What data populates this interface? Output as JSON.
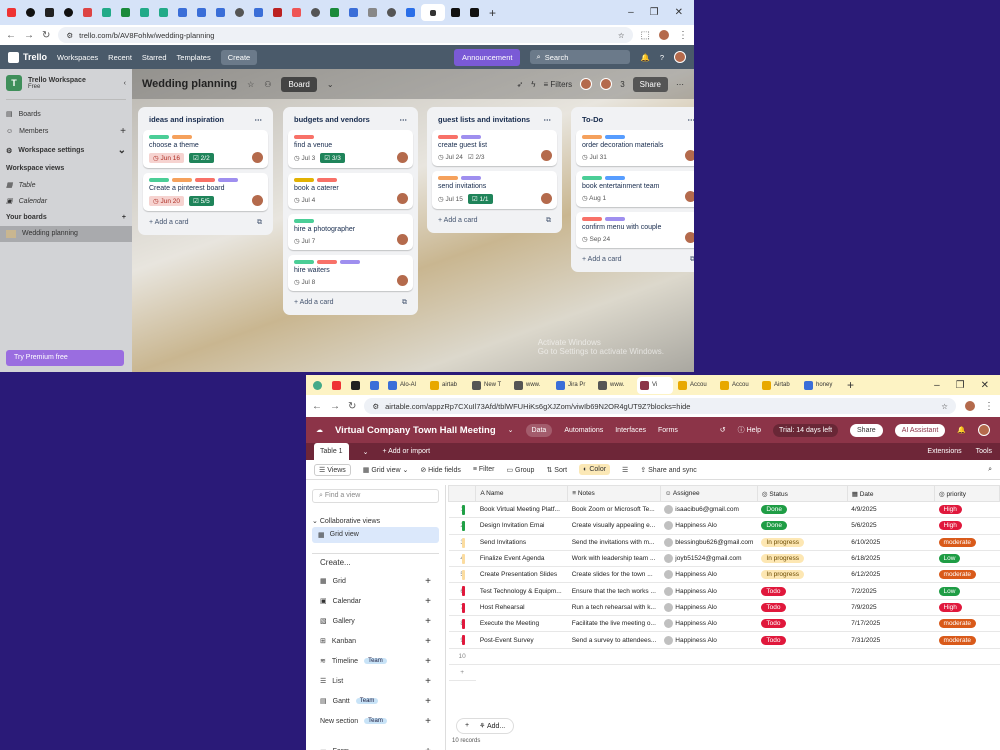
{
  "trello_window": {
    "url": "trello.com/b/AV8Fohlw/wedding-planning",
    "nav": {
      "logo": "Trello",
      "workspaces": "Workspaces",
      "recent": "Recent",
      "starred": "Starred",
      "templates": "Templates",
      "create": "Create",
      "announcement": "Announcement",
      "search_placeholder": "Search"
    },
    "sidebar": {
      "workspace_name": "Trello Workspace",
      "plan": "Free",
      "logo_letter": "T",
      "items": [
        {
          "label": "Boards"
        },
        {
          "label": "Members"
        },
        {
          "label": "Workspace settings"
        }
      ],
      "views_header": "Workspace views",
      "views": [
        {
          "label": "Table"
        },
        {
          "label": "Calendar"
        }
      ],
      "boards_header": "Your boards",
      "board": "Wedding planning",
      "premium": "Try Premium free"
    },
    "board": {
      "title": "Wedding planning",
      "view": "Board",
      "filters": "Filters",
      "share": "Share",
      "member_count": "3",
      "lists": [
        {
          "title": "ideas and inspiration",
          "cards": [
            {
              "title": "choose a theme",
              "labels": [
                "#4bce97",
                "#f5a15c"
              ],
              "due": "Jun 16",
              "check": "2/2"
            },
            {
              "title": "Create a pinterest board",
              "labels": [
                "#4bce97",
                "#f5a15c",
                "#f87168",
                "#9f8fef"
              ],
              "due": "Jun 20",
              "check": "5/5"
            }
          ],
          "add": "Add a card"
        },
        {
          "title": "budgets and vendors",
          "cards": [
            {
              "title": "find a venue",
              "labels": [
                "#f87168"
              ],
              "date": "Jul 3",
              "check": "3/3"
            },
            {
              "title": "book a caterer",
              "labels": [
                "#e2b203",
                "#f87168"
              ],
              "date": "Jul 4"
            },
            {
              "title": "hire a photographer",
              "labels": [
                "#4bce97"
              ],
              "date": "Jul 7"
            },
            {
              "title": "hire waiters",
              "labels": [
                "#4bce97",
                "#f87168",
                "#9f8fef"
              ],
              "date": "Jul 8"
            }
          ],
          "add": "Add a card"
        },
        {
          "title": "guest lists and invitations",
          "cards": [
            {
              "title": "create guest list",
              "labels": [
                "#f87168",
                "#9f8fef"
              ],
              "date": "Jul 24",
              "check": "2/3"
            },
            {
              "title": "send invitations",
              "labels": [
                "#f5a15c",
                "#9f8fef"
              ],
              "date": "Jul 15",
              "check": "1/1"
            }
          ],
          "add": "Add a card"
        },
        {
          "title": "To-Do",
          "cards": [
            {
              "title": "order decoration materials",
              "labels": [
                "#f5a15c",
                "#579dff"
              ],
              "date": "Jul 31"
            },
            {
              "title": "book entertainment team",
              "labels": [
                "#4bce97",
                "#579dff"
              ],
              "date": "Aug 1"
            },
            {
              "title": "confirm menu with couple",
              "labels": [
                "#f87168",
                "#9f8fef"
              ],
              "date": "Sep 24"
            }
          ],
          "add": "Add a card"
        }
      ]
    },
    "watermark": "Activate Windows\nGo to Settings to activate Windows."
  },
  "airtable_window": {
    "tabs": [
      "Alo-Al",
      "airtab",
      "New T",
      "www.",
      "Jira Pr",
      "www.",
      "Vi",
      "Accou",
      "Accou",
      "Airtab",
      "honey"
    ],
    "url": "airtable.com/appzRp7CXuIl73Afd/tblWFUHiKs6gXJZom/viwIb69N2OR4gUT9Z?blocks=hide",
    "header": {
      "title": "Virtual Company Town Hall Meeting",
      "tabs": [
        "Data",
        "Automations",
        "Interfaces",
        "Forms"
      ],
      "help": "Help",
      "trial": "Trial: 14 days left",
      "share": "Share",
      "ai": "AI Assistant"
    },
    "table_tab": "Table 1",
    "add_import": "Add or import",
    "extensions": "Extensions",
    "tools": "Tools",
    "toolbar": {
      "views": "Views",
      "grid_view": "Grid view",
      "hide": "Hide fields",
      "filter": "Filter",
      "group": "Group",
      "sort": "Sort",
      "color": "Color",
      "share_sync": "Share and sync"
    },
    "panel": {
      "find": "Find a view",
      "collab": "Collaborative views",
      "grid": "Grid view",
      "create": "Create...",
      "create_items": [
        {
          "label": "Grid",
          "team": false
        },
        {
          "label": "Calendar",
          "team": false
        },
        {
          "label": "Gallery",
          "team": false
        },
        {
          "label": "Kanban",
          "team": false
        },
        {
          "label": "Timeline",
          "team": true
        },
        {
          "label": "List",
          "team": false
        },
        {
          "label": "Gantt",
          "team": true
        },
        {
          "label": "New section",
          "team": true
        },
        {
          "label": "Form",
          "team": false
        }
      ],
      "team_label": "Team"
    },
    "columns": [
      "Name",
      "Notes",
      "Assignee",
      "Status",
      "Date",
      "priority"
    ],
    "rows": [
      {
        "n": "1",
        "color": "#20a046",
        "name": "Book Virtual Meeting Platf...",
        "notes": "Book Zoom or Microsoft Te...",
        "assignee": "isaacibu6@gmail.com",
        "status": "Done",
        "date": "4/9/2025",
        "priority": "High"
      },
      {
        "n": "2",
        "color": "#20a046",
        "name": "Design Invitation Emai",
        "notes": "Create visually appealing e...",
        "assignee": "Happiness Alo",
        "status": "Done",
        "date": "5/6/2025",
        "priority": "High"
      },
      {
        "n": "3",
        "color": "#fbdca0",
        "name": "Send Invitations",
        "notes": "Send the invitations with m...",
        "assignee": "blessingbu626@gmail.com",
        "status": "In progress",
        "date": "6/10/2025",
        "priority": "moderate"
      },
      {
        "n": "4",
        "color": "#fbdca0",
        "name": "Finalize Event Agenda",
        "notes": "Work with leadership team ...",
        "assignee": "joyb51524@gmail.com",
        "status": "In progress",
        "date": "6/18/2025",
        "priority": "Low"
      },
      {
        "n": "5",
        "color": "#fbdca0",
        "name": "Create Presentation Slides",
        "notes": "Create slides for the town ...",
        "assignee": "Happiness Alo",
        "status": "In progress",
        "date": "6/12/2025",
        "priority": "moderate"
      },
      {
        "n": "6",
        "color": "#e0183c",
        "name": "Test Technology & Equipm...",
        "notes": "Ensure that the tech works ...",
        "assignee": "Happiness Alo",
        "status": "Todo",
        "date": "7/2/2025",
        "priority": "Low"
      },
      {
        "n": "7",
        "color": "#e0183c",
        "name": "Host Rehearsal",
        "notes": "Run a tech rehearsal with k...",
        "assignee": "Happiness Alo",
        "status": "Todo",
        "date": "7/9/2025",
        "priority": "High"
      },
      {
        "n": "8",
        "color": "#e0183c",
        "name": "Execute the Meeting",
        "notes": "Facilitate the live meeting o...",
        "assignee": "Happiness Alo",
        "status": "Todo",
        "date": "7/17/2025",
        "priority": "moderate"
      },
      {
        "n": "9",
        "color": "#e0183c",
        "name": "Post-Event Survey",
        "notes": "Send a survey to attendees...",
        "assignee": "Happiness Alo",
        "status": "Todo",
        "date": "7/31/2025",
        "priority": "moderate"
      }
    ],
    "empty_row": "10",
    "add_label": "Add...",
    "records": "10 records",
    "status_colors": {
      "Done": "#1f9d45",
      "In progress": "#fde7b3",
      "Todo": "#e0183c"
    },
    "priority_colors": {
      "High": "#e0183c",
      "moderate": "#d95a1a",
      "Low": "#1f9d45"
    }
  }
}
